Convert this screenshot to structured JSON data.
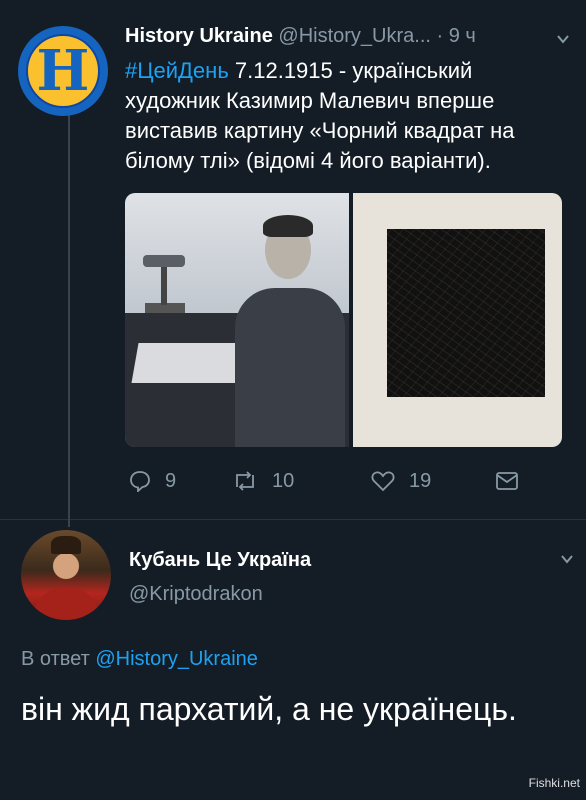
{
  "tweet": {
    "display_name": "History Ukraine",
    "handle": "@History_Ukra...",
    "time": "· 9 ч",
    "avatar_letter": "H",
    "hashtag": "#ЦейДень",
    "text": " 7.12.1915 - український художник Казимир Малевич вперше виставив картину «Чорний квадрат на білому тлі» (відомі 4 його варіанти).",
    "reply_count": "9",
    "retweet_count": "10",
    "like_count": "19"
  },
  "reply": {
    "display_name": "Кубань Це Україна",
    "handle": "@Kriptodrakon",
    "replying_label": "В ответ",
    "replying_to": "@History_Ukraine",
    "text": "він жид пархатий, а не українець."
  },
  "watermark": "Fishki.net",
  "colors": {
    "background": "#141d26",
    "accent": "#1da1f2",
    "secondary_text": "#8899a6"
  },
  "icons": [
    "reply-icon",
    "retweet-icon",
    "like-icon",
    "dm-icon",
    "chevron-down-icon"
  ]
}
